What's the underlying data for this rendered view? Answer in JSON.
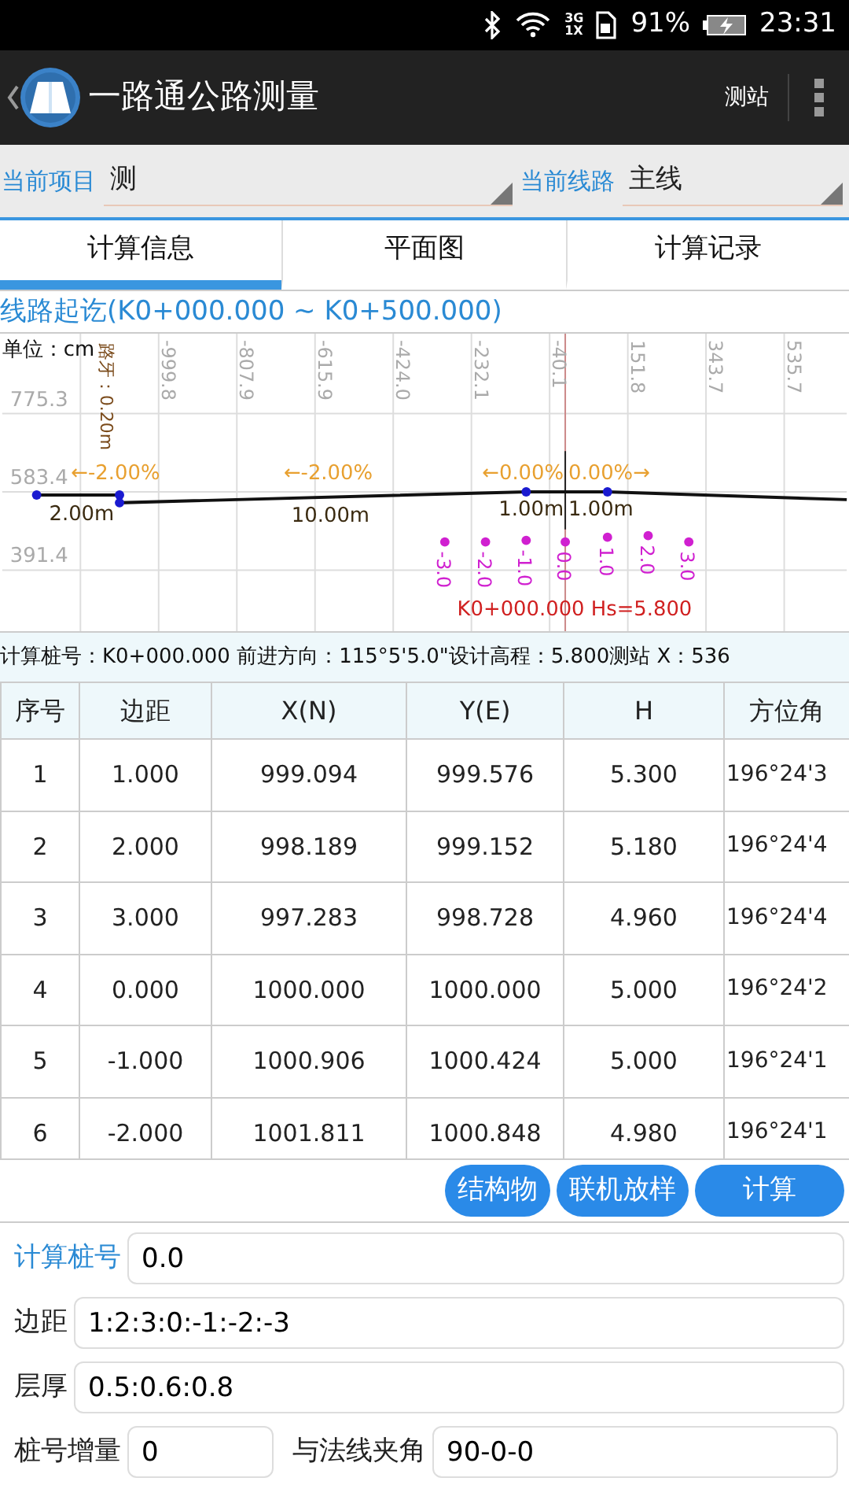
{
  "status_bar": {
    "network": [
      "3G",
      "1X"
    ],
    "battery": "91%",
    "time": "23:31"
  },
  "app_bar": {
    "title": "一路通公路测量",
    "action": "测站"
  },
  "selectors": [
    {
      "label": "当前项目",
      "value": "测"
    },
    {
      "label": "当前线路",
      "value": "主线"
    }
  ],
  "tabs": [
    {
      "label": "计算信息",
      "selected": true
    },
    {
      "label": "平面图",
      "selected": false
    },
    {
      "label": "计算记录",
      "selected": false
    }
  ],
  "range_title": "线路起讫(K0+000.000 ~ K0+500.000)",
  "cross_section": {
    "unit": "单位：cm",
    "curb": "路牙：0.20m",
    "x_labels": [
      "-999.8",
      "-807.9",
      "-615.9",
      "-424.0",
      "-232.1",
      "-40.1",
      "151.8",
      "343.7",
      "535.7"
    ],
    "y_labels": [
      "775.3",
      "583.4",
      "391.4"
    ],
    "segment_labels": [
      {
        "text": "←-2.00%",
        "kind": "slope"
      },
      {
        "text": "←-2.00%",
        "kind": "slope"
      },
      {
        "text": "←0.00%",
        "kind": "slope"
      },
      {
        "text": "0.00%→",
        "kind": "slope"
      },
      {
        "text": "2.00m",
        "kind": "width"
      },
      {
        "text": "10.00m",
        "kind": "width"
      },
      {
        "text": "1.00m",
        "kind": "width"
      },
      {
        "text": "1.00m",
        "kind": "width"
      }
    ],
    "point_labels": [
      "-3.0",
      "-2.0",
      "-1.0",
      "0.0",
      "1.0",
      "2.0",
      "3.0"
    ],
    "station_label": "K0+000.000 Hs=5.800"
  },
  "info_line": "计算桩号：K0+000.000 前进方向：115°5'5.0\"设计高程：5.800测站  X：536",
  "table": {
    "columns": [
      "序号",
      "边距",
      "X(N)",
      "Y(E)",
      "H",
      "方位角"
    ],
    "rows": [
      [
        "1",
        "1.000",
        "999.094",
        "999.576",
        "5.300",
        "196°24'3"
      ],
      [
        "2",
        "2.000",
        "998.189",
        "999.152",
        "5.180",
        "196°24'4"
      ],
      [
        "3",
        "3.000",
        "997.283",
        "998.728",
        "4.960",
        "196°24'4"
      ],
      [
        "4",
        "0.000",
        "1000.000",
        "1000.000",
        "5.000",
        "196°24'2"
      ],
      [
        "5",
        "-1.000",
        "1000.906",
        "1000.424",
        "5.000",
        "196°24'1"
      ],
      [
        "6",
        "-2.000",
        "1001.811",
        "1000.848",
        "4.980",
        "196°24'1"
      ]
    ]
  },
  "buttons": [
    "结构物",
    "联机放样",
    "计算"
  ],
  "form": [
    {
      "label": "计算桩号",
      "value": "0.0",
      "active": true
    },
    {
      "label": "边距",
      "value": "1:2:3:0:-1:-2:-3",
      "active": false
    },
    {
      "label": "层厚",
      "value": "0.5:0.6:0.8",
      "active": false
    }
  ],
  "form_pair": [
    {
      "label": "桩号增量",
      "value": "0",
      "active": false
    },
    {
      "label": "与法线夹角",
      "value": "90-0-0",
      "active": false
    }
  ]
}
